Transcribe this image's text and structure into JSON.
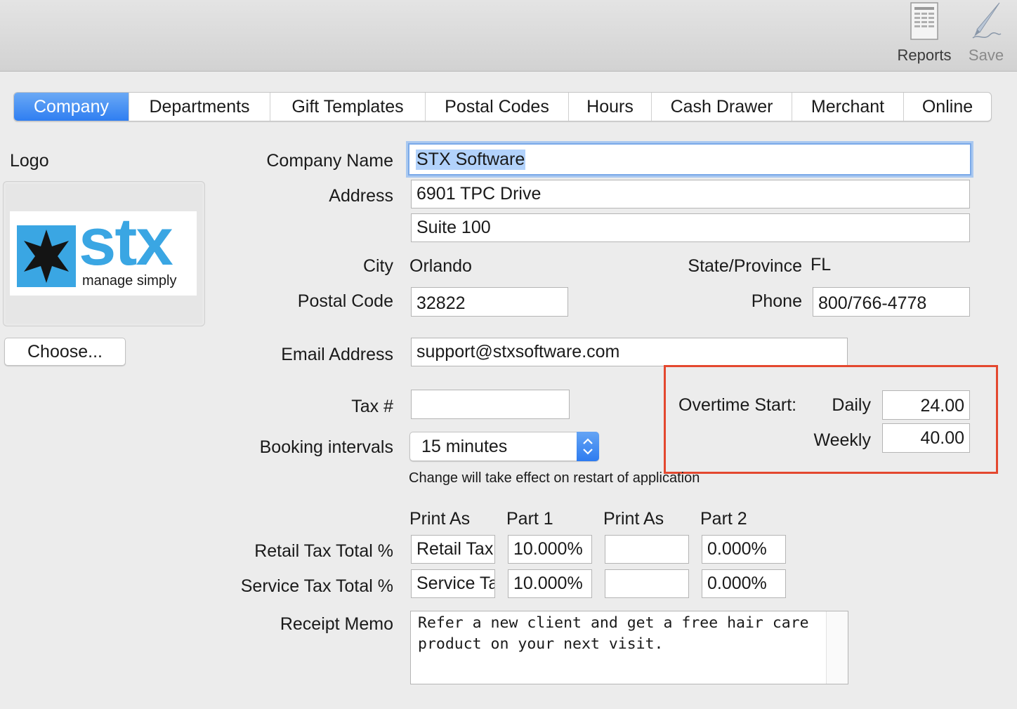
{
  "toolbar": {
    "reports_label": "Reports",
    "save_label": "Save"
  },
  "tabs": [
    {
      "label": "Company",
      "active": true
    },
    {
      "label": "Departments"
    },
    {
      "label": "Gift Templates"
    },
    {
      "label": "Postal Codes"
    },
    {
      "label": "Hours"
    },
    {
      "label": "Cash Drawer"
    },
    {
      "label": "Merchant"
    },
    {
      "label": "Online"
    }
  ],
  "logo": {
    "label": "Logo",
    "brand_text": "stx",
    "tagline": "manage simply",
    "choose_label": "Choose..."
  },
  "company": {
    "name_label": "Company Name",
    "name_value": "STX Software",
    "address_label": "Address",
    "address1_value": "6901 TPC Drive",
    "address2_value": "Suite 100",
    "city_label": "City",
    "city_value": "Orlando",
    "state_label": "State/Province",
    "state_value": "FL",
    "postal_label": "Postal Code",
    "postal_value": "32822",
    "phone_label": "Phone",
    "phone_value": "800/766-4778",
    "email_label": "Email Address",
    "email_value": "support@stxsoftware.com",
    "tax_label": "Tax #",
    "tax_value": ""
  },
  "booking": {
    "label": "Booking intervals",
    "selected": "15 minutes",
    "note": "Change will take effect on restart of application"
  },
  "overtime": {
    "label": "Overtime Start:",
    "daily_label": "Daily",
    "daily_value": "24.00",
    "weekly_label": "Weekly",
    "weekly_value": "40.00"
  },
  "tax_table": {
    "headers": [
      "Print As",
      "Part 1",
      "Print As",
      "Part 2"
    ],
    "rows": [
      {
        "label": "Retail Tax Total %",
        "print_as_1": "Retail Tax",
        "part1": "10.000%",
        "print_as_2": "",
        "part2": "0.000%"
      },
      {
        "label": "Service Tax Total %",
        "print_as_1": "Service Tax",
        "part1": "10.000%",
        "print_as_2": "",
        "part2": "0.000%"
      }
    ]
  },
  "receipt_memo": {
    "label": "Receipt Memo",
    "value": "Refer a new client and get a free hair care product on your next visit."
  },
  "colors": {
    "accent": "#2f7ef1",
    "highlight_box": "#e4482f",
    "logo_blue": "#3aa6e3"
  }
}
